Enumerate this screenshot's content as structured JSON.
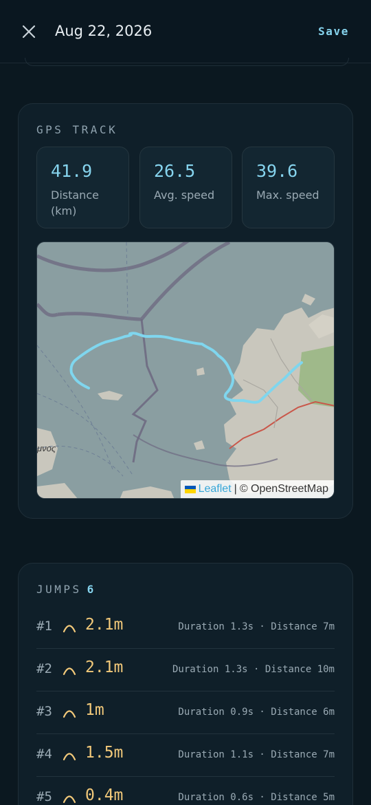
{
  "header": {
    "date": "Aug 22, 2026",
    "save_label": "Save"
  },
  "gps": {
    "section_label": "GPS TRACK",
    "stats": [
      {
        "value": "41.9",
        "label": "Distance (km)"
      },
      {
        "value": "26.5",
        "label": "Avg. speed"
      },
      {
        "value": "39.6",
        "label": "Max. speed"
      }
    ],
    "map": {
      "place_label": "μνος",
      "attribution_leaflet": "Leaflet",
      "attribution_sep": "|",
      "attribution_osm": "© OpenStreetMap",
      "track_color": "#7fd6ee"
    }
  },
  "jumps": {
    "section_label": "JUMPS",
    "count": "6",
    "items": [
      {
        "num": "#1",
        "height": "2.1m",
        "meta": "Duration 1.3s · Distance 7m"
      },
      {
        "num": "#2",
        "height": "2.1m",
        "meta": "Duration 1.3s · Distance 10m"
      },
      {
        "num": "#3",
        "height": "1m",
        "meta": "Duration 0.9s · Distance 6m"
      },
      {
        "num": "#4",
        "height": "1.5m",
        "meta": "Duration 1.1s · Distance 7m"
      },
      {
        "num": "#5",
        "height": "0.4m",
        "meta": "Duration 0.6s · Distance 5m"
      }
    ]
  },
  "colors": {
    "accent": "#86d4ee",
    "height": "#f2c97a",
    "background": "#0b1820"
  }
}
